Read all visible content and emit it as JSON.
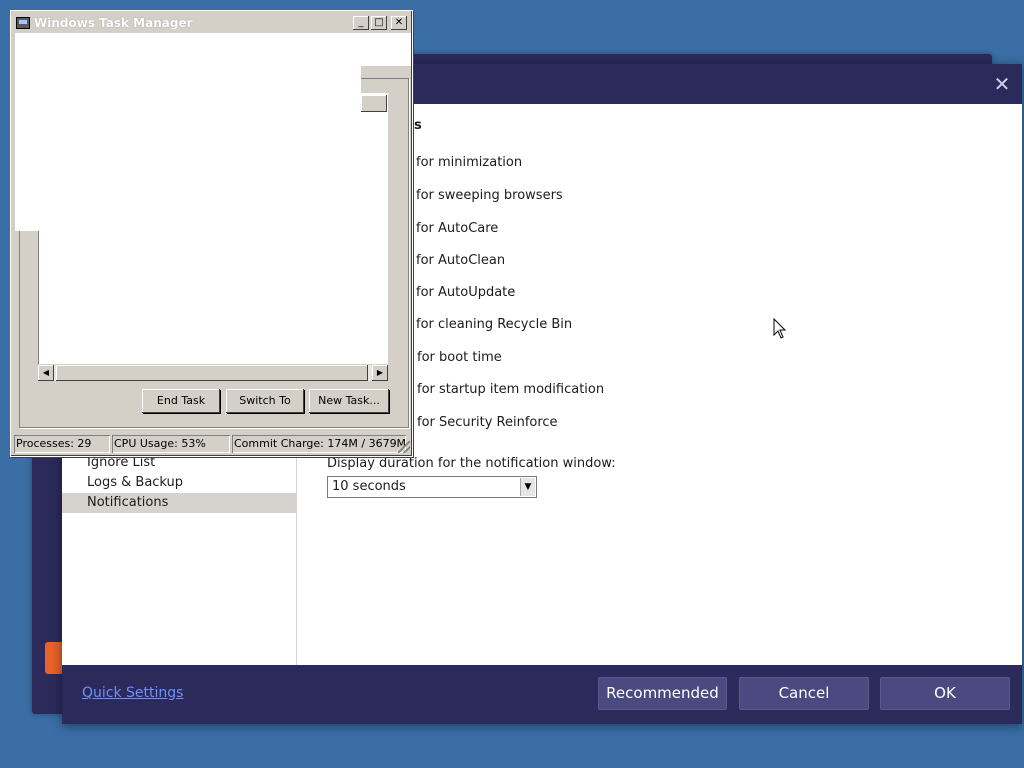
{
  "settings_dialog": {
    "close_glyph": "✕",
    "section_title": "s",
    "notification_options": [
      "for minimization",
      "for sweeping browsers",
      "for AutoCare",
      "for AutoClean",
      "for AutoUpdate",
      "for cleaning Recycle Bin",
      "for boot time",
      "for startup item modification",
      "for Security Reinforce"
    ],
    "duration_label": "Display duration for the notification window:",
    "duration_value": "10 seconds",
    "sidebar_items": [
      {
        "label": "Ignore List",
        "active": false
      },
      {
        "label": "Logs & Backup",
        "active": false
      },
      {
        "label": "Notifications",
        "active": true
      }
    ],
    "footer": {
      "quick_settings": "Quick Settings",
      "recommended": "Recommended",
      "cancel": "Cancel",
      "ok": "OK"
    }
  },
  "task_manager": {
    "title": "Windows Task Manager",
    "buttons": {
      "end_task": "End Task",
      "switch_to": "Switch To",
      "new_task": "New Task..."
    },
    "status": {
      "processes": "Processes: 29",
      "cpu_usage": "CPU Usage: 53%",
      "commit_charge": "Commit Charge: 174M / 3679M"
    }
  },
  "colors": {
    "desktop": "#3a6ea5",
    "dialog_frame": "#2b2a5a",
    "button": "#4a4a80",
    "link": "#6f90ff",
    "accent_orange": "#e8622a"
  }
}
